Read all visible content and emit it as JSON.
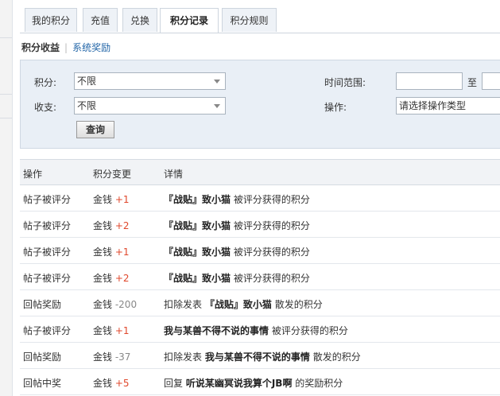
{
  "tabs": [
    {
      "label": "我的积分",
      "active": false
    },
    {
      "label": "充值",
      "active": false
    },
    {
      "label": "兑换",
      "active": false
    },
    {
      "label": "积分记录",
      "active": true
    },
    {
      "label": "积分规则",
      "active": false
    }
  ],
  "subnav": {
    "current": "积分收益",
    "other": "系统奖励"
  },
  "filter": {
    "credit_label": "积分:",
    "credit_value": "不限",
    "type_label": "收支:",
    "type_value": "不限",
    "time_label": "时间范围:",
    "time_to": "至",
    "op_label": "操作:",
    "op_placeholder": "请选择操作类型",
    "query_button": "查询"
  },
  "table": {
    "headers": [
      "操作",
      "积分变更",
      "详情"
    ],
    "rows": [
      {
        "op": "帖子被评分",
        "currency": "金钱",
        "amount": "+1",
        "sign": "pos",
        "prefix": "",
        "subject": "『战贴』致小猫",
        "suffix": "被评分获得的积分"
      },
      {
        "op": "帖子被评分",
        "currency": "金钱",
        "amount": "+2",
        "sign": "pos",
        "prefix": "",
        "subject": "『战贴』致小猫",
        "suffix": "被评分获得的积分"
      },
      {
        "op": "帖子被评分",
        "currency": "金钱",
        "amount": "+1",
        "sign": "pos",
        "prefix": "",
        "subject": "『战贴』致小猫",
        "suffix": "被评分获得的积分"
      },
      {
        "op": "帖子被评分",
        "currency": "金钱",
        "amount": "+2",
        "sign": "pos",
        "prefix": "",
        "subject": "『战贴』致小猫",
        "suffix": "被评分获得的积分"
      },
      {
        "op": "回帖奖励",
        "currency": "金钱",
        "amount": "-200",
        "sign": "neg",
        "prefix": "扣除发表",
        "subject": "『战贴』致小猫",
        "suffix": "散发的积分"
      },
      {
        "op": "帖子被评分",
        "currency": "金钱",
        "amount": "+1",
        "sign": "pos",
        "prefix": "",
        "subject": "我与某兽不得不说的事情",
        "suffix": "被评分获得的积分"
      },
      {
        "op": "回帖奖励",
        "currency": "金钱",
        "amount": "-37",
        "sign": "neg",
        "prefix": "扣除发表",
        "subject": "我与某兽不得不说的事情",
        "suffix": "散发的积分"
      },
      {
        "op": "回帖中奖",
        "currency": "金钱",
        "amount": "+5",
        "sign": "pos",
        "prefix": "回复",
        "subject": "听说某幽冥说我算个JB啊",
        "suffix": "的奖励积分"
      }
    ]
  }
}
